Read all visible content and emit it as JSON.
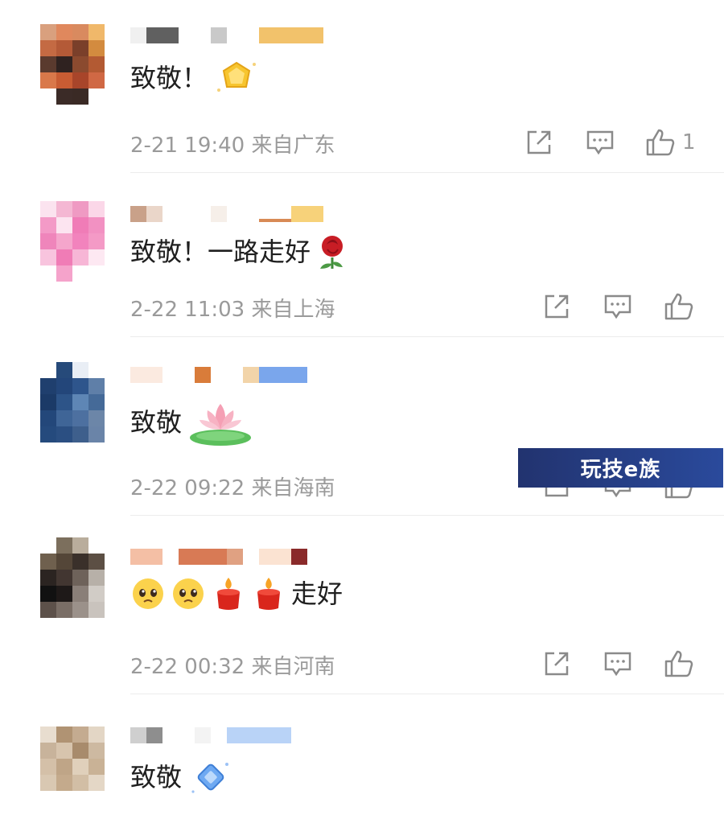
{
  "comments": [
    {
      "text": "致敬！",
      "time": "2-21 19:40",
      "location": "来自广东",
      "likes": "1"
    },
    {
      "text": "致敬！一路走好",
      "time": "2-22 11:03",
      "location": "来自上海",
      "likes": ""
    },
    {
      "text": "致敬",
      "time": "2-22 09:22",
      "location": "来自海南",
      "likes": ""
    },
    {
      "text": "走好",
      "time": "2-22 00:32",
      "location": "来自河南",
      "likes": ""
    },
    {
      "text": "致敬",
      "time": "",
      "location": "",
      "likes": ""
    }
  ],
  "watermark": "玩技e族",
  "icons": {
    "share": "share-icon",
    "comment": "comment-icon",
    "like": "thumb-up-icon"
  },
  "colors": {
    "meta_text": "#9a9a9a",
    "divider": "#ececec",
    "watermark_bg": "#22336f"
  }
}
